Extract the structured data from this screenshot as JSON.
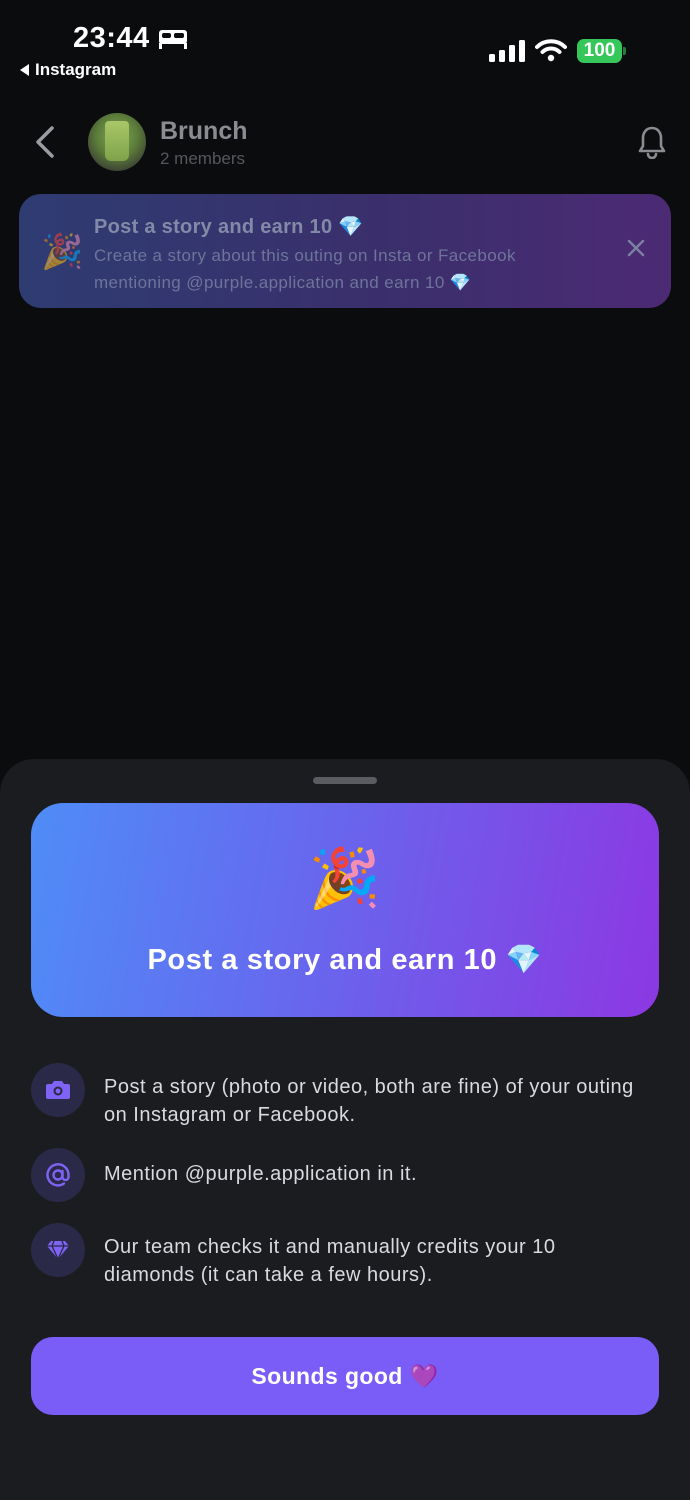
{
  "status_bar": {
    "time": "23:44",
    "back_app": "Instagram",
    "battery": "100",
    "battery_color": "#35c759"
  },
  "header": {
    "group_name": "Brunch",
    "members": "2 members",
    "icons": [
      "back-chevron-icon",
      "bell-icon"
    ]
  },
  "banner": {
    "emoji": "🎉",
    "title": "Post a story and earn 10 💎",
    "text": "Create a story about this outing on Insta or Facebook mentioning @purple.application and earn 10 💎"
  },
  "sheet": {
    "hero": {
      "emoji": "🎉",
      "title": "Post a story and earn 10 💎"
    },
    "steps": [
      {
        "icon": "camera-icon",
        "text": "Post a story (photo or video, both are fine) of your outing on Instagram or Facebook."
      },
      {
        "icon": "at-sign-icon",
        "text": "Mention @purple.application in it."
      },
      {
        "icon": "diamond-icon",
        "text": "Our team checks it and manually credits your 10 diamonds (it can take a few hours)."
      }
    ],
    "cta_label": "Sounds good 💜"
  },
  "colors": {
    "background": "#0b0c0e",
    "sheet": "#1b1c20",
    "accent": "#7a5cf7",
    "hero_gradient_start": "#4f8cf7",
    "hero_gradient_end": "#8c38e2"
  }
}
